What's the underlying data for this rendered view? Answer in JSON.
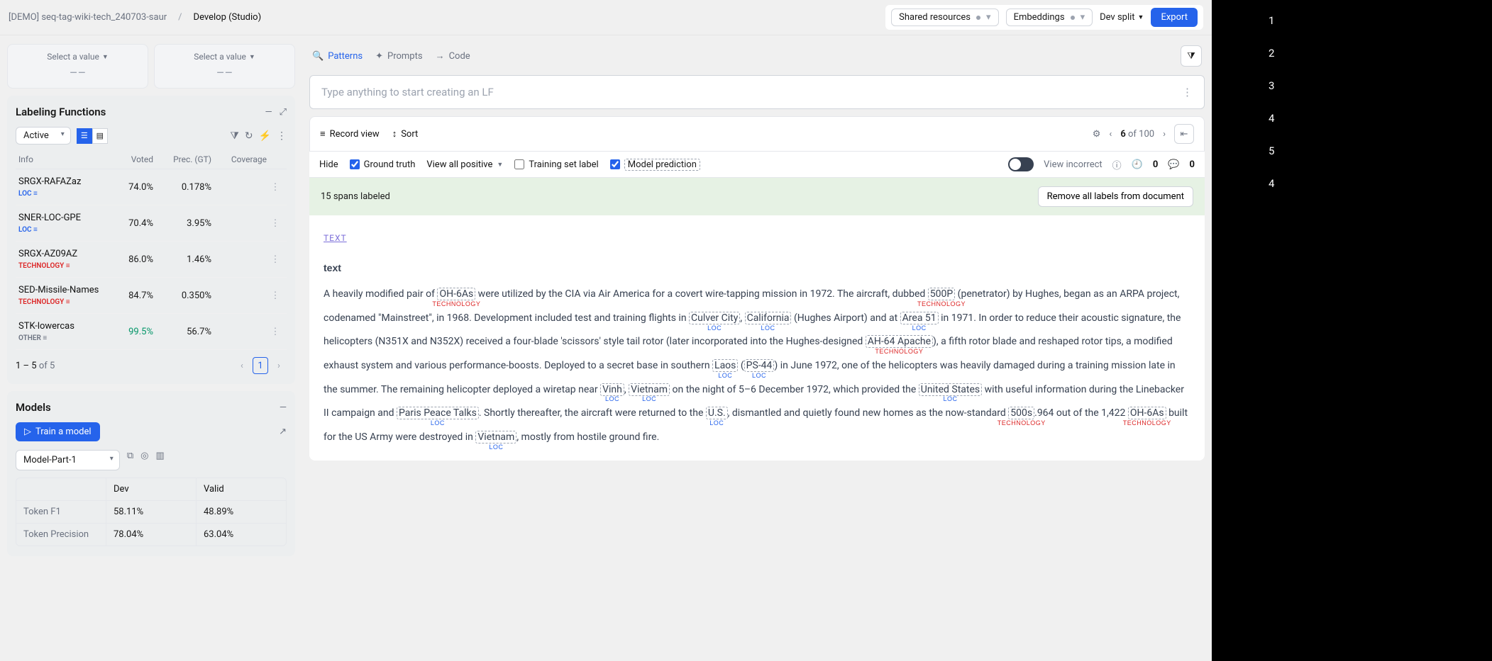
{
  "breadcrumb": {
    "project": "[DEMO] seq-tag-wiki-tech_240703-saur",
    "page": "Develop (Studio)"
  },
  "topbar": {
    "shared": "Shared resources",
    "embeddings": "Embeddings",
    "split": "Dev split",
    "export": "Export"
  },
  "selectors": {
    "label": "Select a value",
    "empty": "––"
  },
  "tabs": {
    "patterns": "Patterns",
    "prompts": "Prompts",
    "code": "Code"
  },
  "lf_input_placeholder": "Type anything to start creating an LF",
  "record_bar": {
    "record_view": "Record view",
    "sort": "Sort",
    "current": "6",
    "of": "of",
    "total": "100"
  },
  "subbar": {
    "hide": "Hide",
    "ground_truth": "Ground truth",
    "view_all_positive": "View all positive",
    "training_set": "Training set label",
    "model_pred": "Model prediction",
    "view_incorrect": "View incorrect",
    "zero": "0"
  },
  "spans_bar": {
    "count": "15 spans labeled",
    "remove": "Remove all labels from document"
  },
  "doc_header": {
    "text_link": "TEXT",
    "heading": "text"
  },
  "lf_panel": {
    "title": "Labeling Functions",
    "active": "Active",
    "cols": {
      "info": "Info",
      "voted": "Voted",
      "prec": "Prec. (GT)",
      "coverage": "Coverage"
    },
    "rows": [
      {
        "name": "SRGX-RAFAZaz",
        "tag": "LOC",
        "voted": "74.0%",
        "prec": "0.178%"
      },
      {
        "name": "SNER-LOC-GPE",
        "tag": "LOC",
        "voted": "70.4%",
        "prec": "3.95%"
      },
      {
        "name": "SRGX-AZ09AZ",
        "tag": "TECHNOLOGY",
        "voted": "86.0%",
        "prec": "1.46%"
      },
      {
        "name": "SED-Missile-Names",
        "tag": "TECHNOLOGY",
        "voted": "84.7%",
        "prec": "0.350%"
      },
      {
        "name": "STK-lowercas",
        "tag": "OTHER",
        "voted": "99.5%",
        "prec": "56.7%",
        "green": true
      }
    ],
    "pager": {
      "text1": "1 – 5",
      "of": "of",
      "text2": "5",
      "page": "1"
    }
  },
  "models_panel": {
    "title": "Models",
    "train": "Train a model",
    "select": "Model-Part-1",
    "head": {
      "dev": "Dev",
      "valid": "Valid"
    },
    "rows": [
      {
        "k": "Token F1",
        "dev": "58.11%",
        "valid": "48.89%"
      },
      {
        "k": "Token Precision",
        "dev": "78.04%",
        "valid": "63.04%"
      }
    ]
  },
  "doc_tokens": [
    {
      "t": "A heavily modified pair of "
    },
    {
      "t": "OH-6As",
      "lab": "TECHNOLOGY"
    },
    {
      "t": " were utilized by the CIA via Air America for a covert wire-tapping mission in 1972. The aircraft, dubbed "
    },
    {
      "t": "500P",
      "lab": "TECHNOLOGY"
    },
    {
      "t": " (penetrator) by Hughes, began as an ARPA project, codenamed \"Mainstreet\", in 1968.  Development included test and training flights in "
    },
    {
      "t": "Culver City",
      "lab": "LOC"
    },
    {
      "t": ", "
    },
    {
      "t": "California",
      "lab": "LOC"
    },
    {
      "t": " (Hughes Airport) and at "
    },
    {
      "t": "Area 51",
      "lab": "LOC"
    },
    {
      "t": " in 1971. In order to reduce their acoustic signature, the helicopters (N351X and N352X) received a four-blade 'scissors' style tail rotor (later incorporated into the Hughes-designed "
    },
    {
      "t": "AH-64 Apache",
      "lab": "TECHNOLOGY"
    },
    {
      "t": "), a fifth rotor blade and reshaped rotor tips, a modified exhaust system and various performance-boosts.  Deployed to a secret base in southern "
    },
    {
      "t": "Laos",
      "lab": "LOC"
    },
    {
      "t": " ("
    },
    {
      "t": "PS-44",
      "lab": "LOC"
    },
    {
      "t": ") in June 1972, one of the helicopters was heavily damaged during a training mission late in the summer.  The remaining helicopter deployed a wiretap near "
    },
    {
      "t": "Vinh",
      "lab": "LOC"
    },
    {
      "t": ", "
    },
    {
      "t": "Vietnam",
      "lab": "LOC"
    },
    {
      "t": " on the night of 5–6 December 1972, which provided the "
    },
    {
      "t": "United States",
      "lab": "LOC"
    },
    {
      "t": " with useful information during the Linebacker II campaign and "
    },
    {
      "t": "Paris Peace Talks",
      "lab": "LOC"
    },
    {
      "t": ". Shortly thereafter, the aircraft were returned to the "
    },
    {
      "t": "U.S.",
      "lab": "LOC"
    },
    {
      "t": ", dismantled and quietly found new homes as the now-standard "
    },
    {
      "t": "500s",
      "lab": "TECHNOLOGY"
    },
    {
      "t": ".964 out of the 1,422 "
    },
    {
      "t": "OH-6As",
      "lab": "TECHNOLOGY"
    },
    {
      "t": " built for the US Army were destroyed in "
    },
    {
      "t": "Vietnam",
      "lab": "LOC"
    },
    {
      "t": ", mostly from hostile ground fire."
    }
  ],
  "right_numbers": [
    "1",
    "2",
    "3",
    "4",
    "5",
    "4"
  ]
}
